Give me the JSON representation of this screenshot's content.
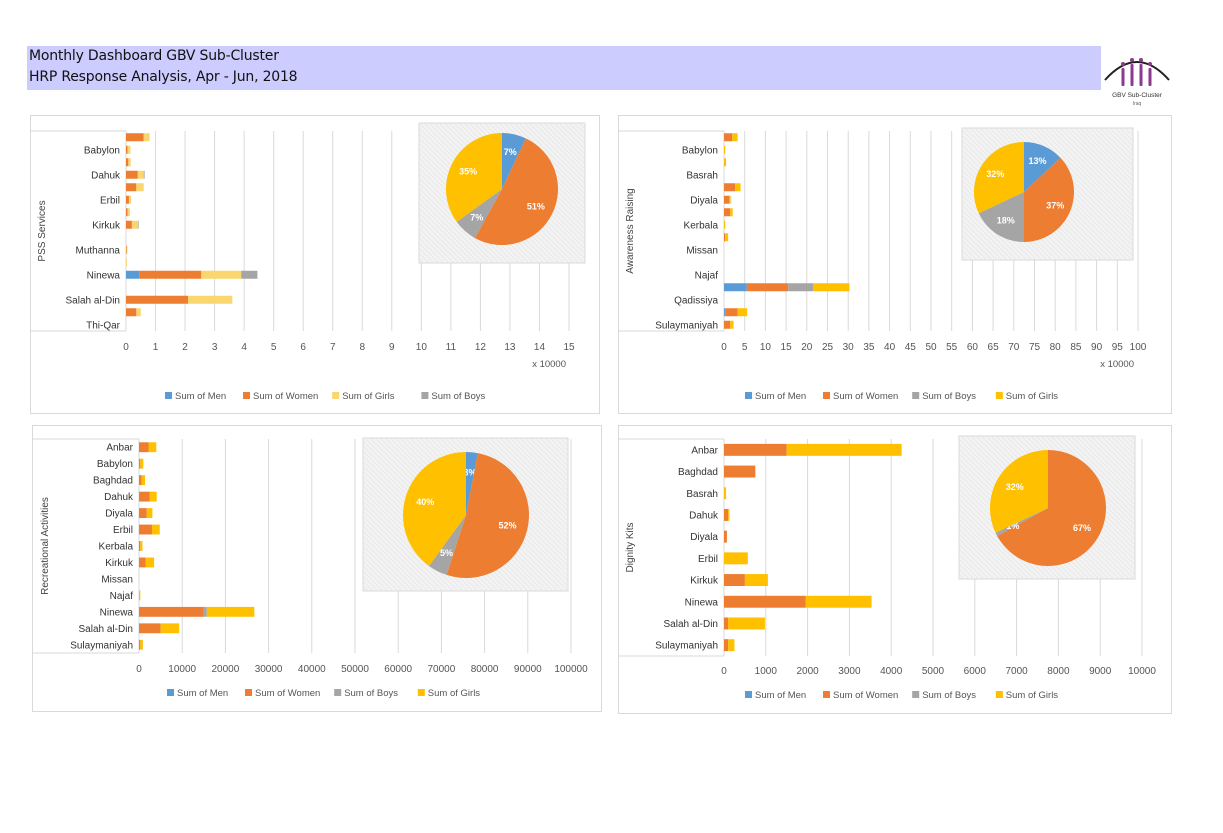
{
  "header": {
    "title": "Monthly Dashboard GBV Sub-Cluster",
    "subtitle": "HRP Response Analysis, Apr - Jun, 2018",
    "logo_text": "GBV Sub-Cluster",
    "logo_subtext": "Iraq"
  },
  "colors": {
    "men": "#5b9bd5",
    "women": "#ed7d31",
    "boys": "#a5a5a5",
    "girls": "#ffc000",
    "girls_light": "#fad66f"
  },
  "chart_data": [
    {
      "type": "bar",
      "orientation": "horizontal-stacked",
      "ylabel": "PSS Services",
      "xlim": [
        0,
        15
      ],
      "xtick_step": 1,
      "x_unit_label": "x 10000",
      "categories": [
        "",
        "Babylon",
        "",
        "Dahuk",
        "",
        "Erbil",
        "",
        "Kirkuk",
        "",
        "Muthanna",
        "",
        "Ninewa",
        "",
        "Salah al-Din",
        "",
        "Thi-Qar"
      ],
      "series": [
        {
          "name": "Sum of Men",
          "color": "#5b9bd5",
          "values": [
            0,
            0,
            0,
            0,
            0,
            0,
            0,
            0,
            0,
            0,
            0,
            0.45,
            0,
            0,
            0,
            0
          ]
        },
        {
          "name": "Sum of Women",
          "color": "#ed7d31",
          "values": [
            0.6,
            0.05,
            0.08,
            0.4,
            0.35,
            0.1,
            0.05,
            0.2,
            0,
            0.02,
            0,
            2.1,
            0,
            2.1,
            0.35,
            0
          ]
        },
        {
          "name": "Sum of Girls",
          "color": "#fad66f",
          "values": [
            0.2,
            0.1,
            0.08,
            0.2,
            0.25,
            0.07,
            0.08,
            0.2,
            0,
            0.02,
            0.03,
            1.35,
            0,
            1.5,
            0.15,
            0
          ]
        },
        {
          "name": "Sum of Boys",
          "color": "#a5a5a5",
          "values": [
            0,
            0,
            0,
            0.03,
            0,
            0,
            0,
            0.02,
            0,
            0,
            0,
            0.55,
            0,
            0,
            0,
            0
          ]
        }
      ],
      "legend": [
        "Sum of Men",
        "Sum of Women",
        "Sum of Girls",
        "Sum of Boys"
      ],
      "pie": {
        "slices": [
          {
            "name": "Sum of Men",
            "color": "#5b9bd5",
            "percent": 7,
            "label": "7%"
          },
          {
            "name": "Sum of Women",
            "color": "#ed7d31",
            "percent": 51,
            "label": "51%"
          },
          {
            "name": "Sum of Boys",
            "color": "#a5a5a5",
            "percent": 7,
            "label": "7%"
          },
          {
            "name": "Sum of Girls",
            "color": "#ffc000",
            "percent": 35,
            "label": "35%"
          }
        ]
      }
    },
    {
      "type": "bar",
      "orientation": "horizontal-stacked",
      "ylabel": "Awareness Raising",
      "xlim": [
        0,
        100
      ],
      "xtick_step": 5,
      "x_unit_label": "x 10000",
      "categories": [
        "",
        "Babylon",
        "",
        "Basrah",
        "",
        "Diyala",
        "",
        "Kerbala",
        "",
        "Missan",
        "",
        "Najaf",
        "",
        "Qadissiya",
        "",
        "Sulaymaniyah"
      ],
      "series": [
        {
          "name": "Sum of Men",
          "color": "#5b9bd5",
          "values": [
            0,
            0,
            0,
            0,
            0,
            0,
            0,
            0,
            0,
            0,
            0,
            0,
            5.5,
            0,
            0.3,
            0
          ]
        },
        {
          "name": "Sum of Women",
          "color": "#ed7d31",
          "values": [
            2,
            0,
            0,
            0,
            2.7,
            1.3,
            1.5,
            0,
            0.3,
            0,
            0,
            0,
            10,
            0,
            3,
            1.5
          ]
        },
        {
          "name": "Sum of Boys",
          "color": "#a5a5a5",
          "values": [
            0,
            0,
            0,
            0,
            0,
            0,
            0,
            0,
            0,
            0,
            0,
            0,
            6,
            0,
            0,
            0
          ]
        },
        {
          "name": "Sum of Girls",
          "color": "#ffc000",
          "values": [
            1.3,
            0.3,
            0.5,
            0,
            1.3,
            0.3,
            0.6,
            0.3,
            0.7,
            0,
            0,
            0,
            8.8,
            0,
            2.3,
            0.8
          ]
        }
      ],
      "legend": [
        "Sum of Men",
        "Sum of Women",
        "Sum of Boys",
        "Sum of Girls"
      ],
      "pie": {
        "slices": [
          {
            "name": "Sum of Men",
            "color": "#5b9bd5",
            "percent": 13,
            "label": "13%"
          },
          {
            "name": "Sum of Women",
            "color": "#ed7d31",
            "percent": 37,
            "label": "37%"
          },
          {
            "name": "Sum of Boys",
            "color": "#a5a5a5",
            "percent": 18,
            "label": "18%"
          },
          {
            "name": "Sum of Girls",
            "color": "#ffc000",
            "percent": 32,
            "label": "32%"
          }
        ]
      }
    },
    {
      "type": "bar",
      "orientation": "horizontal-stacked",
      "ylabel": "Recreational Activities",
      "xlim": [
        0,
        100000
      ],
      "xtick_step": 10000,
      "x_unit_label": "",
      "categories": [
        "Anbar",
        "Babylon",
        "Baghdad",
        "Dahuk",
        "Diyala",
        "Erbil",
        "Kerbala",
        "Kirkuk",
        "Missan",
        "Najaf",
        "Ninewa",
        "Salah al-Din",
        "Sulaymaniyah"
      ],
      "series": [
        {
          "name": "Sum of Men",
          "color": "#5b9bd5",
          "values": [
            0,
            0,
            0,
            0,
            0,
            0,
            0,
            0,
            0,
            0,
            0,
            0,
            0
          ]
        },
        {
          "name": "Sum of Women",
          "color": "#ed7d31",
          "values": [
            2200,
            300,
            600,
            2500,
            1800,
            3000,
            300,
            1500,
            0,
            0,
            15000,
            5000,
            300
          ]
        },
        {
          "name": "Sum of Boys",
          "color": "#a5a5a5",
          "values": [
            0,
            0,
            0,
            0,
            0,
            0,
            0,
            0,
            0,
            0,
            700,
            0,
            0
          ]
        },
        {
          "name": "Sum of Girls",
          "color": "#ffc000",
          "values": [
            1800,
            700,
            800,
            1600,
            1300,
            1800,
            500,
            2000,
            0,
            300,
            11000,
            4300,
            600
          ]
        }
      ],
      "legend": [
        "Sum of Men",
        "Sum of Women",
        "Sum of Boys",
        "Sum of Girls"
      ],
      "pie": {
        "slices": [
          {
            "name": "Sum of Men",
            "color": "#5b9bd5",
            "percent": 3,
            "label": "3%"
          },
          {
            "name": "Sum of Women",
            "color": "#ed7d31",
            "percent": 52,
            "label": "52%"
          },
          {
            "name": "Sum of Boys",
            "color": "#a5a5a5",
            "percent": 5,
            "label": "5%"
          },
          {
            "name": "Sum of Girls",
            "color": "#ffc000",
            "percent": 40,
            "label": "40%"
          }
        ]
      }
    },
    {
      "type": "bar",
      "orientation": "horizontal-stacked",
      "ylabel": "Dignity Kits",
      "xlim": [
        0,
        10000
      ],
      "xtick_step": 1000,
      "x_unit_label": "",
      "categories": [
        "Anbar",
        "Baghdad",
        "Basrah",
        "Dahuk",
        "Diyala",
        "Erbil",
        "Kirkuk",
        "Ninewa",
        "Salah al-Din",
        "Sulaymaniyah"
      ],
      "series": [
        {
          "name": "Sum of Men",
          "color": "#5b9bd5",
          "values": [
            0,
            0,
            0,
            0,
            0,
            0,
            0,
            0,
            0,
            0
          ]
        },
        {
          "name": "Sum of Women",
          "color": "#ed7d31",
          "values": [
            1500,
            750,
            0,
            100,
            70,
            0,
            500,
            1950,
            100,
            100
          ]
        },
        {
          "name": "Sum of Boys",
          "color": "#a5a5a5",
          "values": [
            0,
            0,
            0,
            0,
            0,
            0,
            0,
            0,
            0,
            0
          ]
        },
        {
          "name": "Sum of Girls",
          "color": "#ffc000",
          "values": [
            2750,
            0,
            50,
            30,
            0,
            570,
            550,
            1580,
            880,
            150
          ]
        }
      ],
      "legend": [
        "Sum of Men",
        "Sum of Women",
        "Sum of Boys",
        "Sum of Girls"
      ],
      "pie": {
        "slices": [
          {
            "name": "Sum of Men",
            "color": "#5b9bd5",
            "percent": 0,
            "label": "0%"
          },
          {
            "name": "Sum of Women",
            "color": "#ed7d31",
            "percent": 67,
            "label": "67%"
          },
          {
            "name": "Sum of Boys",
            "color": "#a5a5a5",
            "percent": 1,
            "label": "1%"
          },
          {
            "name": "Sum of Girls",
            "color": "#ffc000",
            "percent": 32,
            "label": "32%"
          }
        ]
      }
    }
  ]
}
